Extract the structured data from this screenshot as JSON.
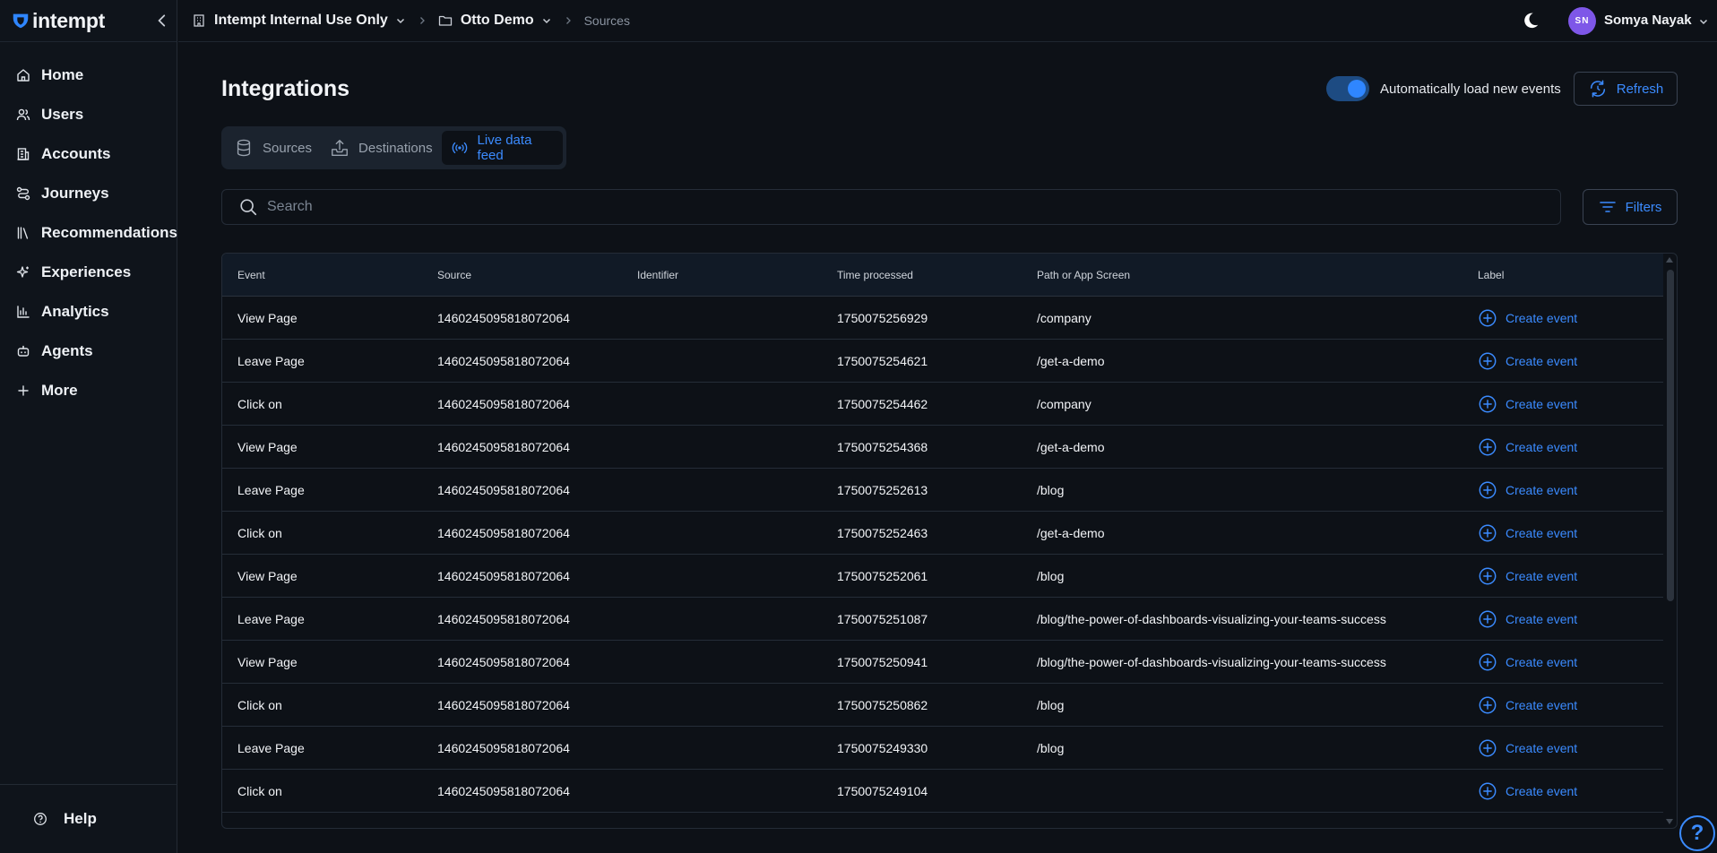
{
  "sidebar": {
    "logo_text": "intempt",
    "items": [
      {
        "label": "Home",
        "icon": "home-icon"
      },
      {
        "label": "Users",
        "icon": "users-icon"
      },
      {
        "label": "Accounts",
        "icon": "building-icon"
      },
      {
        "label": "Journeys",
        "icon": "journey-icon"
      },
      {
        "label": "Recommendations",
        "icon": "library-icon"
      },
      {
        "label": "Experiences",
        "icon": "sparkle-icon"
      },
      {
        "label": "Analytics",
        "icon": "bar-chart-icon"
      },
      {
        "label": "Agents",
        "icon": "robot-icon"
      },
      {
        "label": "More",
        "icon": "plus-icon"
      }
    ],
    "help_label": "Help"
  },
  "topbar": {
    "org": "Intempt Internal Use Only",
    "project": "Otto Demo",
    "current": "Sources",
    "user_initials": "SN",
    "user_name": "Somya Nayak"
  },
  "main": {
    "title": "Integrations",
    "auto_load_label": "Automatically load new events",
    "auto_load_on": true,
    "refresh_label": "Refresh",
    "tabs": [
      {
        "label": "Sources",
        "active": false
      },
      {
        "label": "Destinations",
        "active": false
      },
      {
        "label": "Live data feed",
        "active": true
      }
    ],
    "search_placeholder": "Search",
    "filters_label": "Filters"
  },
  "table": {
    "columns": [
      "Event",
      "Source",
      "Identifier",
      "Time processed",
      "Path or App Screen",
      "Label"
    ],
    "action_label": "Create event",
    "rows": [
      {
        "event": "View Page",
        "source": "1460245095818072064",
        "identifier": "",
        "time": "1750075256929",
        "path": "/company"
      },
      {
        "event": "Leave Page",
        "source": "1460245095818072064",
        "identifier": "",
        "time": "1750075254621",
        "path": "/get-a-demo"
      },
      {
        "event": "Click on",
        "source": "1460245095818072064",
        "identifier": "",
        "time": "1750075254462",
        "path": "/company"
      },
      {
        "event": "View Page",
        "source": "1460245095818072064",
        "identifier": "",
        "time": "1750075254368",
        "path": "/get-a-demo"
      },
      {
        "event": "Leave Page",
        "source": "1460245095818072064",
        "identifier": "",
        "time": "1750075252613",
        "path": "/blog"
      },
      {
        "event": "Click on",
        "source": "1460245095818072064",
        "identifier": "",
        "time": "1750075252463",
        "path": "/get-a-demo"
      },
      {
        "event": "View Page",
        "source": "1460245095818072064",
        "identifier": "",
        "time": "1750075252061",
        "path": "/blog"
      },
      {
        "event": "Leave Page",
        "source": "1460245095818072064",
        "identifier": "",
        "time": "1750075251087",
        "path": "/blog/the-power-of-dashboards-visualizing-your-teams-success"
      },
      {
        "event": "View Page",
        "source": "1460245095818072064",
        "identifier": "",
        "time": "1750075250941",
        "path": "/blog/the-power-of-dashboards-visualizing-your-teams-success"
      },
      {
        "event": "Click on",
        "source": "1460245095818072064",
        "identifier": "",
        "time": "1750075250862",
        "path": "/blog"
      },
      {
        "event": "Leave Page",
        "source": "1460245095818072064",
        "identifier": "",
        "time": "1750075249330",
        "path": "/blog"
      },
      {
        "event": "Click on",
        "source": "1460245095818072064",
        "identifier": "",
        "time": "1750075249104",
        "path": ""
      }
    ]
  },
  "colors": {
    "accent": "#3b8bff",
    "background": "#0d1117",
    "avatar": "#7e57e8"
  }
}
